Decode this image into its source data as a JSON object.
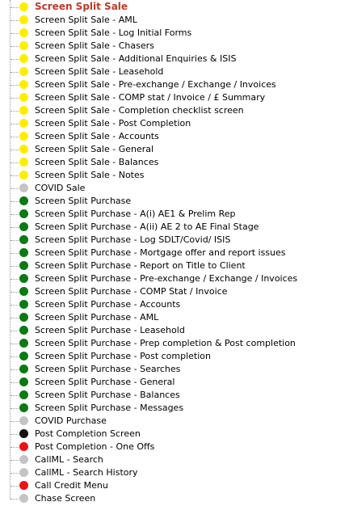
{
  "colors": {
    "yellow": "#ffee00",
    "green": "#0a7a12",
    "gray": "#c4c4c4",
    "black": "#111111",
    "red": "#ee1111",
    "selected_text": "#c0392b"
  },
  "tree": {
    "items": [
      {
        "label": "Screen Split Sale",
        "status": "yellow",
        "selected": true
      },
      {
        "label": "Screen Split Sale - AML",
        "status": "yellow"
      },
      {
        "label": "Screen Split Sale - Log Initial Forms",
        "status": "yellow"
      },
      {
        "label": "Screen Split Sale - Chasers",
        "status": "yellow"
      },
      {
        "label": "Screen Split Sale - Additional Enquiries & ISIS",
        "status": "yellow"
      },
      {
        "label": "Screen Split Sale - Leasehold",
        "status": "yellow"
      },
      {
        "label": "Screen Split Sale - Pre-exchange / Exchange / Invoices",
        "status": "yellow"
      },
      {
        "label": "Screen Split Sale - COMP stat / Invoice / £ Summary",
        "status": "yellow"
      },
      {
        "label": "Screen Split Sale - Completion checklist screen",
        "status": "yellow"
      },
      {
        "label": "Screen Split Sale - Post Completion",
        "status": "yellow"
      },
      {
        "label": "Screen Split Sale - Accounts",
        "status": "yellow"
      },
      {
        "label": "Screen Split Sale - General",
        "status": "yellow"
      },
      {
        "label": "Screen Split Sale - Balances",
        "status": "yellow"
      },
      {
        "label": "Screen Split Sale - Notes",
        "status": "yellow"
      },
      {
        "label": "COVID Sale",
        "status": "gray"
      },
      {
        "label": "Screen Split Purchase",
        "status": "green"
      },
      {
        "label": "Screen Split Purchase - A(i) AE1 & Prelim Rep",
        "status": "green"
      },
      {
        "label": "Screen Split Purchase - A(ii) AE 2 to AE Final Stage",
        "status": "green"
      },
      {
        "label": "Screen Split Purchase - Log SDLT/Covid/ ISIS",
        "status": "green"
      },
      {
        "label": "Screen Split Purchase - Mortgage offer and report issues",
        "status": "green"
      },
      {
        "label": "Screen Split Purchase - Report on Title to Client",
        "status": "green"
      },
      {
        "label": "Screen Split Purchase - Pre-exchange / Exchange / Invoices",
        "status": "green"
      },
      {
        "label": "Screen Split Purchase - COMP Stat / Invoice",
        "status": "green"
      },
      {
        "label": "Screen Split Purchase - Accounts",
        "status": "green"
      },
      {
        "label": "Screen Split Purchase - AML",
        "status": "green"
      },
      {
        "label": "Screen Split Purchase - Leasehold",
        "status": "green"
      },
      {
        "label": "Screen Split Purchase - Prep completion & Post completion",
        "status": "green"
      },
      {
        "label": "Screen Split Purchase - Post completion",
        "status": "green"
      },
      {
        "label": "Screen Split Purchase - Searches",
        "status": "green"
      },
      {
        "label": "Screen Split Purchase - General",
        "status": "green"
      },
      {
        "label": "Screen Split Purchase - Balances",
        "status": "green"
      },
      {
        "label": "Screen Split Purchase - Messages",
        "status": "green"
      },
      {
        "label": "COVID Purchase",
        "status": "gray"
      },
      {
        "label": "Post Completion Screen",
        "status": "black"
      },
      {
        "label": "Post Completion - One Offs",
        "status": "red"
      },
      {
        "label": "CallML - Search",
        "status": "gray"
      },
      {
        "label": "CallML - Search History",
        "status": "gray"
      },
      {
        "label": "Call Credit Menu",
        "status": "red"
      },
      {
        "label": "Chase Screen",
        "status": "gray"
      }
    ]
  }
}
